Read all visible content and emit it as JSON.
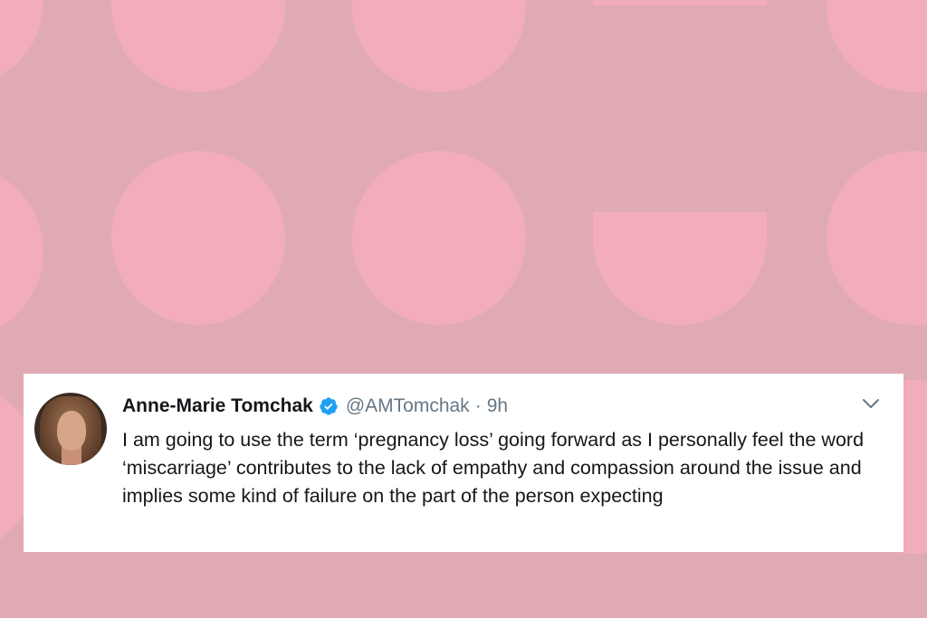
{
  "tweet": {
    "display_name": "Anne-Marie Tomchak",
    "handle": "@AMTomchak",
    "separator": "·",
    "timestamp": "9h",
    "text": "I am going to use the term ‘pregnancy loss’ going forward as I personally feel the word ‘miscarriage’ contributes to the lack of empathy and compassion around the issue and implies some kind of failure on the part of the person expecting",
    "icons": {
      "verified": "verified-badge-icon",
      "menu": "chevron-down-icon"
    }
  },
  "colors": {
    "background": "#dfaab4",
    "pattern": "#f3acbb",
    "card": "#ffffff",
    "verified": "#1da1f2",
    "secondary_text": "#657786"
  }
}
